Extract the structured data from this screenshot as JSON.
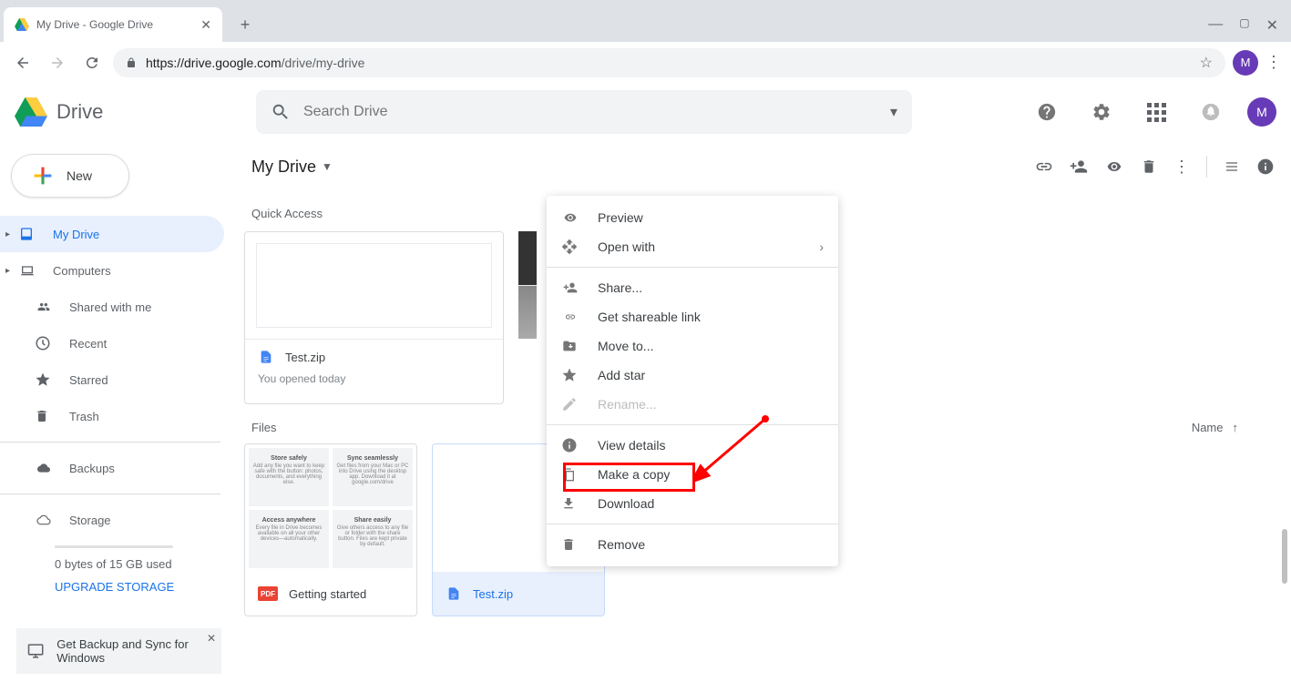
{
  "browser": {
    "tab_title": "My Drive - Google Drive",
    "url_host": "https://drive.google.com",
    "url_path": "/drive/my-drive",
    "avatar_letter": "M"
  },
  "header": {
    "app_name": "Drive",
    "search_placeholder": "Search Drive",
    "avatar_letter": "M"
  },
  "sidebar": {
    "new_label": "New",
    "items": [
      {
        "label": "My Drive",
        "expandable": true
      },
      {
        "label": "Computers",
        "expandable": true
      },
      {
        "label": "Shared with me",
        "expandable": false
      },
      {
        "label": "Recent",
        "expandable": false
      },
      {
        "label": "Starred",
        "expandable": false
      },
      {
        "label": "Trash",
        "expandable": false
      }
    ],
    "backups_label": "Backups",
    "storage_label": "Storage",
    "storage_used": "0 bytes of 15 GB used",
    "upgrade_label": "UPGRADE STORAGE",
    "backup_bar": "Get Backup and Sync for Windows"
  },
  "main": {
    "breadcrumb": "My Drive",
    "quick_access_title": "Quick Access",
    "files_title": "Files",
    "col_name": "Name",
    "quick_cards": [
      {
        "name": "Test.zip",
        "subtitle": "You opened today"
      }
    ],
    "file_cards": [
      {
        "name": "Getting started"
      },
      {
        "name": "Test.zip"
      }
    ],
    "gs_preview": {
      "c1_title": "Store safely",
      "c1_body": "Add any file you want to keep safe with the button: photos, documents, and everything else.",
      "c2_title": "Sync seamlessly",
      "c2_body": "Get files from your Mac or PC into Drive using the desktop app. Download it at google.com/drive",
      "c3_title": "Access anywhere",
      "c3_body": "Every file in Drive becomes available on all your other devices—automatically.",
      "c4_title": "Share easily",
      "c4_body": "Give others access to any file or folder with the share button. Files are kept private by default."
    }
  },
  "ctx": {
    "preview": "Preview",
    "open_with": "Open with",
    "share": "Share...",
    "get_link": "Get shareable link",
    "move_to": "Move to...",
    "add_star": "Add star",
    "rename": "Rename...",
    "view_details": "View details",
    "make_copy": "Make a copy",
    "download": "Download",
    "remove": "Remove"
  }
}
